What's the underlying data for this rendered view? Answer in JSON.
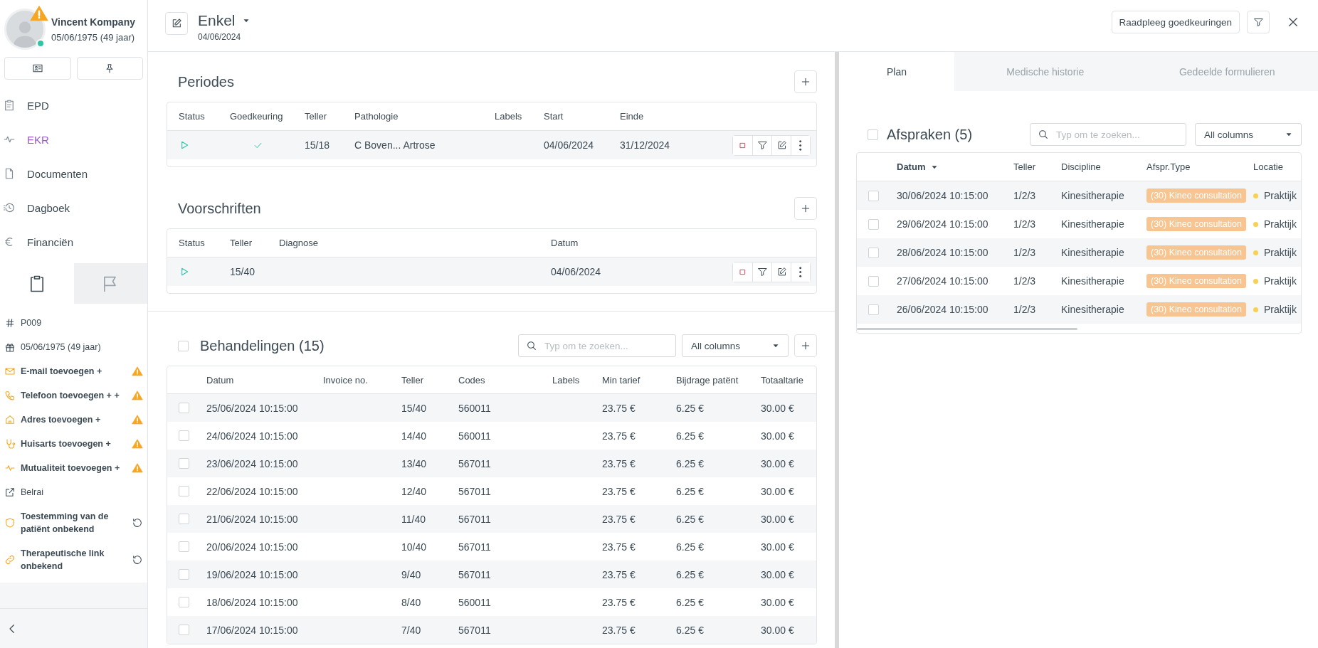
{
  "patient": {
    "name": "Vincent Kompany",
    "birth": "05/06/1975 (49 jaar)",
    "warning": true,
    "online": true
  },
  "nav": [
    {
      "label": "EPD",
      "selected": false
    },
    {
      "label": "EKR",
      "selected": true
    },
    {
      "label": "Documenten",
      "selected": false
    },
    {
      "label": "Dagboek",
      "selected": false
    },
    {
      "label": "Financiën",
      "selected": false
    }
  ],
  "info_tabs": [
    {
      "selected": true
    },
    {
      "selected": false
    }
  ],
  "info": [
    {
      "text": "P009",
      "missing": false,
      "unknown": false
    },
    {
      "text": "05/06/1975 (49 jaar)",
      "missing": false,
      "unknown": false
    },
    {
      "text": "E-mail toevoegen +",
      "missing": true,
      "unknown": false
    },
    {
      "text": "Telefoon toevoegen + +",
      "missing": true,
      "unknown": false
    },
    {
      "text": "Adres toevoegen +",
      "missing": true,
      "unknown": false
    },
    {
      "text": "Huisarts toevoegen +",
      "missing": true,
      "unknown": false
    },
    {
      "text": "Mutualiteit toevoegen +",
      "missing": true,
      "unknown": false
    },
    {
      "text": "Belrai",
      "missing": false,
      "unknown": false
    },
    {
      "text": "Toestemming van de patiënt onbekend",
      "missing": false,
      "unknown": true
    },
    {
      "text": "Therapeutische link onbekend",
      "missing": false,
      "unknown": true
    }
  ],
  "header": {
    "title": "Enkel",
    "date": "04/06/2024",
    "consult_button": "Raadpleeg goedkeuringen"
  },
  "periodes": {
    "title": "Periodes",
    "columns": [
      "Status",
      "Goedkeuring",
      "Teller",
      "Pathologie",
      "Labels",
      "Start",
      "Einde"
    ],
    "rows": [
      {
        "approved": true,
        "teller": "15/18",
        "pathologie": "C Boven... Artrose",
        "start": "04/06/2024",
        "einde": "31/12/2024"
      }
    ]
  },
  "voorschriften": {
    "title": "Voorschriften",
    "columns": [
      "Status",
      "Teller",
      "Diagnose",
      "Datum"
    ],
    "rows": [
      {
        "teller": "15/40",
        "datum": "04/06/2024"
      }
    ]
  },
  "behandelingen": {
    "title": "Behandelingen (15)",
    "checked": false,
    "search_placeholder": "Typ om te zoeken...",
    "filter": "All columns",
    "columns": [
      "Datum",
      "Invoice no.",
      "Teller",
      "Codes",
      "Labels",
      "Min tarief",
      "Bijdrage patënt",
      "Totaaltarie"
    ],
    "rows": [
      {
        "checked": false,
        "cells": [
          "25/06/2024 10:15:00",
          "",
          "15/40",
          "560011",
          "",
          "23.75 €",
          "6.25 €",
          "30.00 €"
        ]
      },
      {
        "checked": false,
        "cells": [
          "24/06/2024 10:15:00",
          "",
          "14/40",
          "560011",
          "",
          "23.75 €",
          "6.25 €",
          "30.00 €"
        ]
      },
      {
        "checked": false,
        "cells": [
          "23/06/2024 10:15:00",
          "",
          "13/40",
          "567011",
          "",
          "23.75 €",
          "6.25 €",
          "30.00 €"
        ]
      },
      {
        "checked": false,
        "cells": [
          "22/06/2024 10:15:00",
          "",
          "12/40",
          "567011",
          "",
          "23.75 €",
          "6.25 €",
          "30.00 €"
        ]
      },
      {
        "checked": false,
        "cells": [
          "21/06/2024 10:15:00",
          "",
          "11/40",
          "567011",
          "",
          "23.75 €",
          "6.25 €",
          "30.00 €"
        ]
      },
      {
        "checked": false,
        "cells": [
          "20/06/2024 10:15:00",
          "",
          "10/40",
          "567011",
          "",
          "23.75 €",
          "6.25 €",
          "30.00 €"
        ]
      },
      {
        "checked": false,
        "cells": [
          "19/06/2024 10:15:00",
          "",
          "9/40",
          "567011",
          "",
          "23.75 €",
          "6.25 €",
          "30.00 €"
        ]
      },
      {
        "checked": false,
        "cells": [
          "18/06/2024 10:15:00",
          "",
          "8/40",
          "560011",
          "",
          "23.75 €",
          "6.25 €",
          "30.00 €"
        ]
      },
      {
        "checked": false,
        "cells": [
          "17/06/2024 10:15:00",
          "",
          "7/40",
          "567011",
          "",
          "23.75 €",
          "6.25 €",
          "30.00 €"
        ]
      }
    ]
  },
  "right_tabs": [
    {
      "label": "Plan",
      "selected": true
    },
    {
      "label": "Medische historie",
      "selected": false
    },
    {
      "label": "Gedeelde formulieren",
      "selected": false
    }
  ],
  "afspraken": {
    "title": "Afspraken (5)",
    "checked": false,
    "search_placeholder": "Typ om te zoeken...",
    "filter": "All columns",
    "columns": [
      {
        "label": "Datum",
        "sorted": true
      },
      {
        "label": "Teller",
        "sorted": false
      },
      {
        "label": "Discipline",
        "sorted": false
      },
      {
        "label": "Afspr.Type",
        "sorted": false
      },
      {
        "label": "Locatie",
        "sorted": false
      }
    ],
    "rows": [
      {
        "checked": false,
        "datum": "30/06/2024 10:15:00",
        "teller": "1/2/3",
        "discipline": "Kinesitherapie",
        "type": "(30) Kineo consultation",
        "locatie": "Praktijk",
        "color": "#f7d154"
      },
      {
        "checked": false,
        "datum": "29/06/2024 10:15:00",
        "teller": "1/2/3",
        "discipline": "Kinesitherapie",
        "type": "(30) Kineo consultation",
        "locatie": "Praktijk",
        "color": "#f7d154"
      },
      {
        "checked": false,
        "datum": "28/06/2024 10:15:00",
        "teller": "1/2/3",
        "discipline": "Kinesitherapie",
        "type": "(30) Kineo consultation",
        "locatie": "Praktijk",
        "color": "#f7d154"
      },
      {
        "checked": false,
        "datum": "27/06/2024 10:15:00",
        "teller": "1/2/3",
        "discipline": "Kinesitherapie",
        "type": "(30) Kineo consultation",
        "locatie": "Praktijk",
        "color": "#f7d154"
      },
      {
        "checked": false,
        "datum": "26/06/2024 10:15:00",
        "teller": "1/2/3",
        "discipline": "Kinesitherapie",
        "type": "(30) Kineo consultation",
        "locatie": "Praktijk",
        "color": "#f7d154"
      }
    ]
  }
}
